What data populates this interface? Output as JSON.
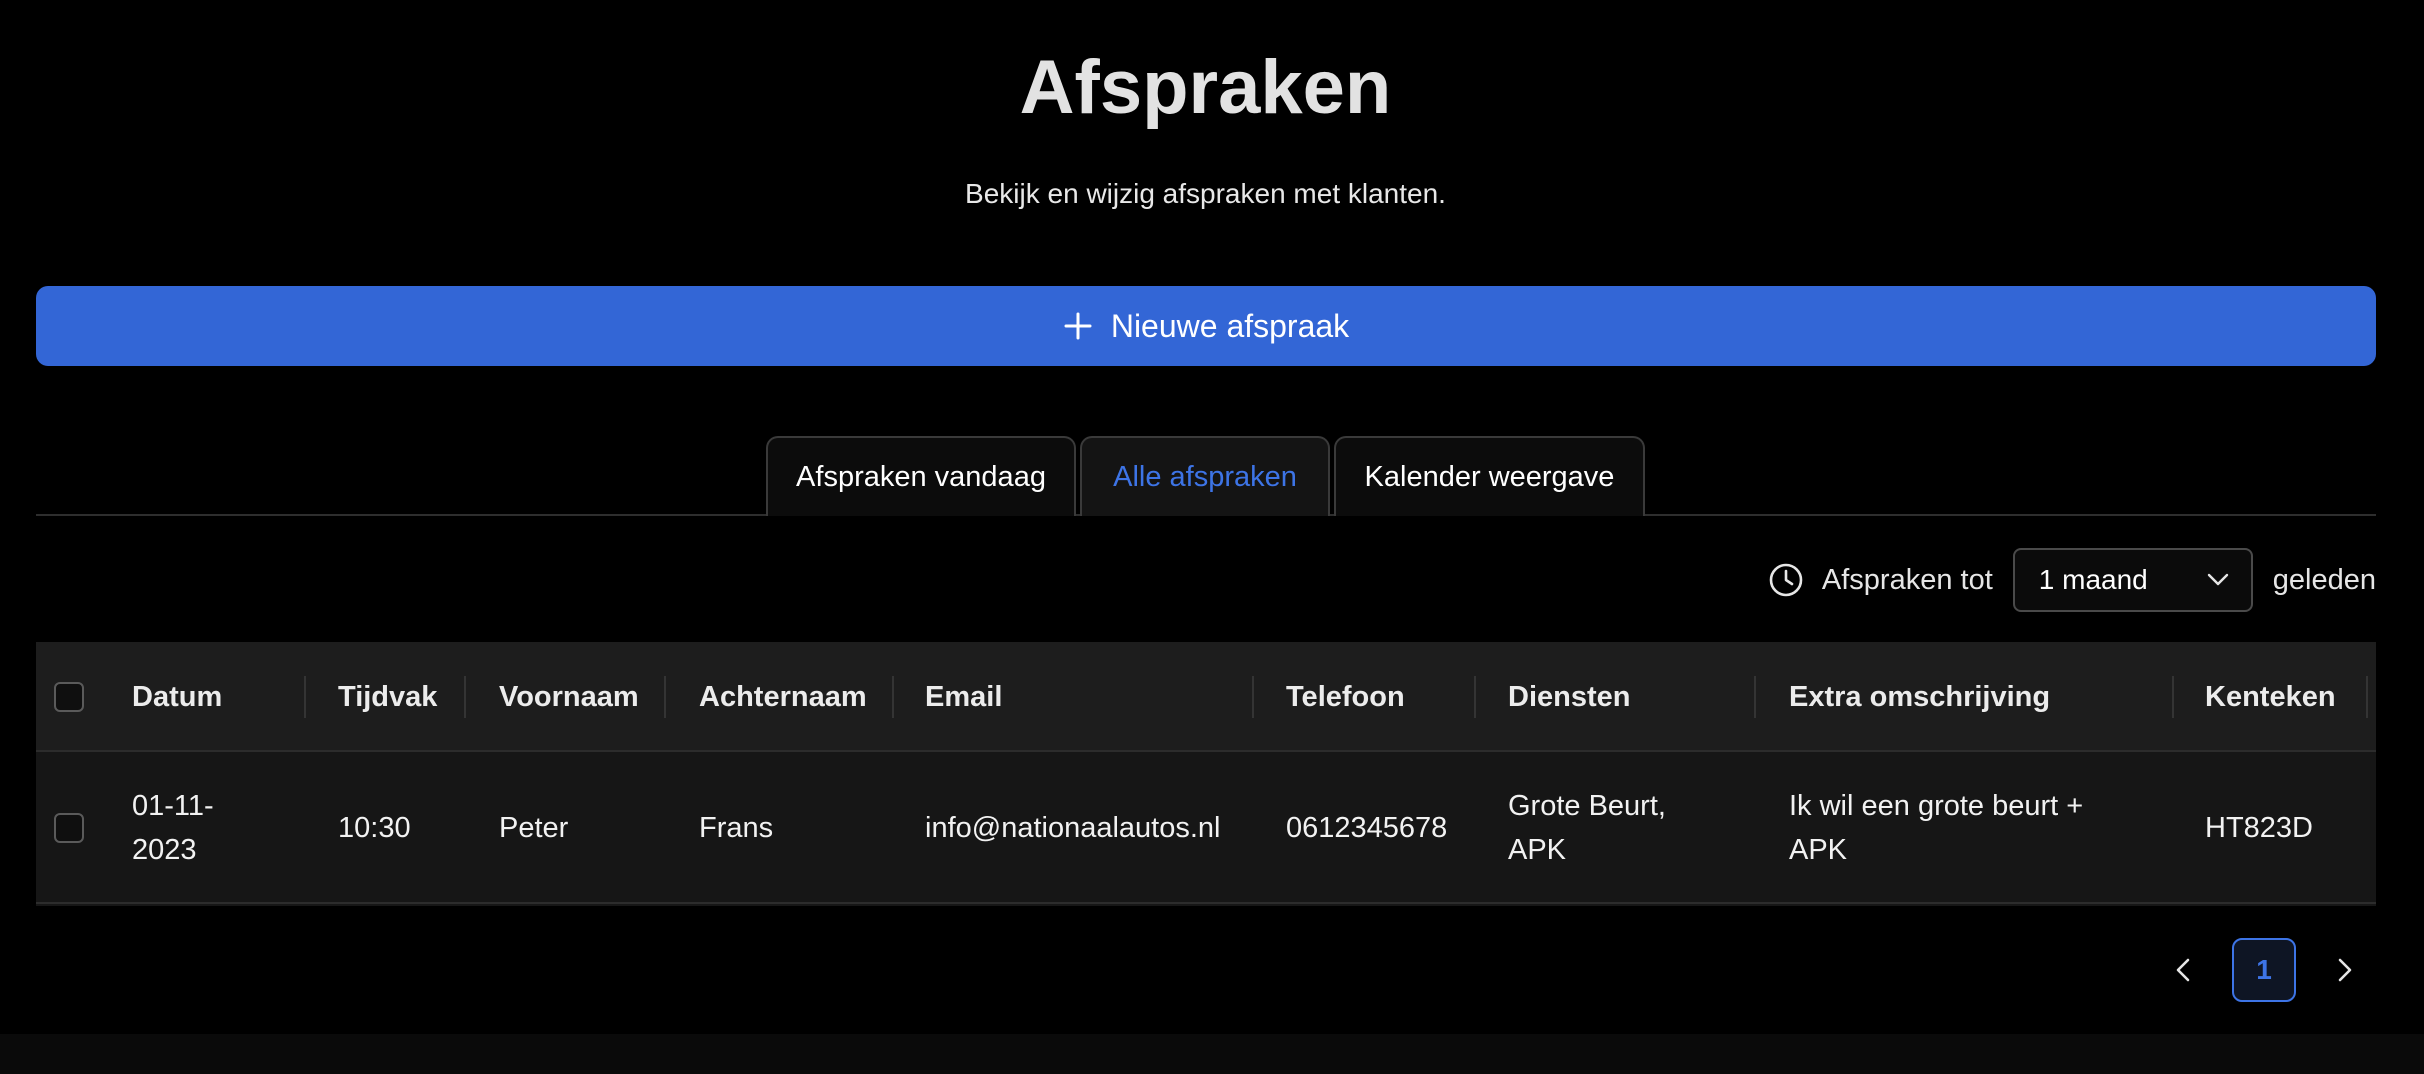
{
  "header": {
    "title": "Afspraken",
    "subtitle": "Bekijk en wijzig afspraken met klanten."
  },
  "new_button": {
    "label": "Nieuwe afspraak",
    "icon": "plus-icon"
  },
  "tabs": [
    {
      "label": "Afspraken vandaag",
      "active": false
    },
    {
      "label": "Alle afspraken",
      "active": true
    },
    {
      "label": "Kalender weergave",
      "active": false
    }
  ],
  "filter": {
    "icon": "clock-icon",
    "label": "Afspraken tot",
    "selected": "1 maand",
    "suffix": "geleden"
  },
  "table": {
    "columns": [
      "Datum",
      "Tijdvak",
      "Voornaam",
      "Achternaam",
      "Email",
      "Telefoon",
      "Diensten",
      "Extra omschrijving",
      "Kenteken"
    ],
    "rows": [
      {
        "datum_line1": "01-11-",
        "datum_line2": "2023",
        "tijdvak": "10:30",
        "voornaam": "Peter",
        "achternaam": "Frans",
        "email": "info@nationaalautos.nl",
        "telefoon": "0612345678",
        "diensten_line1": "Grote Beurt,",
        "diensten_line2": "APK",
        "extra_line1": "Ik wil een grote beurt +",
        "extra_line2": "APK",
        "kenteken": "HT823D"
      }
    ]
  },
  "pagination": {
    "current_page": "1"
  },
  "colors": {
    "accent": "#3366d6",
    "link": "#3d74e6",
    "background": "#000000"
  }
}
